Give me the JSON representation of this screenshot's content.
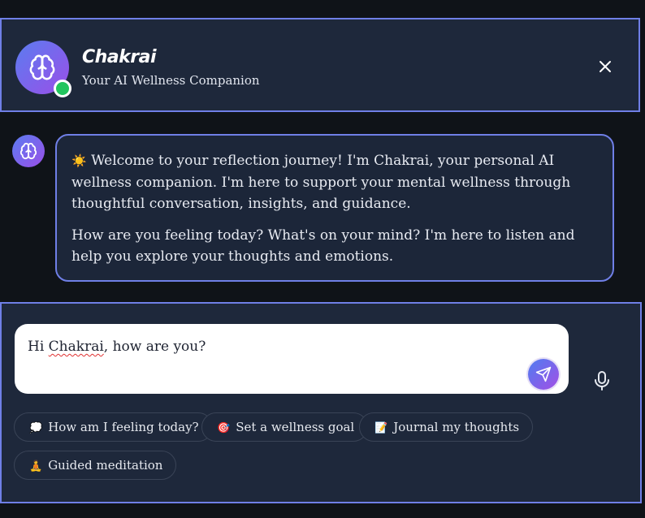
{
  "header": {
    "app_name": "Chakrai",
    "subtitle": "Your AI Wellness Companion",
    "close_icon": "close-icon",
    "avatar_icon": "brain-icon",
    "status": "online"
  },
  "message": {
    "avatar_icon": "brain-icon",
    "sun_emoji": "☀️",
    "paragraph1": "Welcome to your reflection journey! I'm Chakrai, your personal AI wellness companion. I'm here to support your mental wellness through thoughtful conversation, insights, and guidance.",
    "paragraph2": "How are you feeling today? What's on your mind? I'm here to listen and help you explore your thoughts and emotions."
  },
  "composer": {
    "input_pre": "Hi ",
    "input_misspelled": "Chakrai",
    "input_post": ", how are you?",
    "send_icon": "send-icon",
    "mic_icon": "microphone-icon"
  },
  "quick_actions": [
    {
      "emoji": "💭",
      "label": "How am I feeling today?"
    },
    {
      "emoji": "🎯",
      "label": "Set a wellness goal"
    },
    {
      "emoji": "📝",
      "label": "Journal my thoughts"
    },
    {
      "emoji": "🧘",
      "label": "Guided meditation"
    }
  ],
  "colors": {
    "accent_border": "#6f7fe6",
    "panel_bg": "#1e283b",
    "page_bg": "#0f1318",
    "online": "#22c55e",
    "gradient_start": "#5b7cf0",
    "gradient_end": "#9a4fe8"
  }
}
